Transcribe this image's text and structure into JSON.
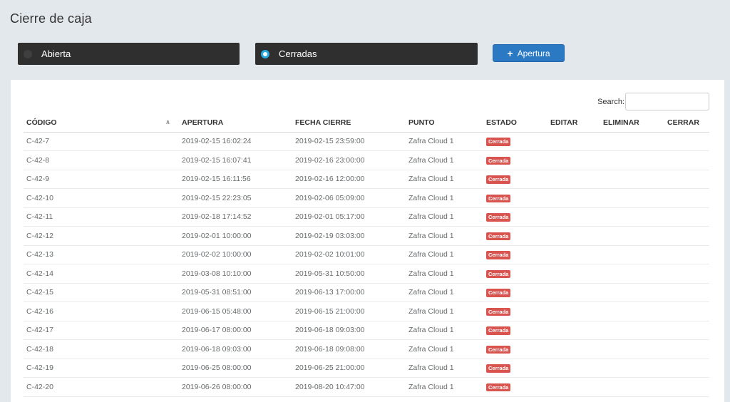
{
  "page": {
    "title": "Cierre de caja"
  },
  "filters": {
    "open_label": "Abierta",
    "closed_label": "Cerradas"
  },
  "actions": {
    "apertura_label": "Apertura"
  },
  "search": {
    "label": "Search:",
    "value": ""
  },
  "table": {
    "headers": {
      "codigo": "CÓDIGO",
      "apertura": "APERTURA",
      "fecha_cierre": "FECHA CIERRE",
      "punto": "PUNTO",
      "estado": "ESTADO",
      "editar": "EDITAR",
      "eliminar": "ELIMINAR",
      "cerrar": "CERRAR"
    },
    "rows": [
      {
        "codigo": "C-42-7",
        "apertura": "2019-02-15 16:02:24",
        "cierre": "2019-02-15 23:59:00",
        "punto": "Zafra Cloud 1",
        "estado": "Cerrada"
      },
      {
        "codigo": "C-42-8",
        "apertura": "2019-02-15 16:07:41",
        "cierre": "2019-02-16 23:00:00",
        "punto": "Zafra Cloud 1",
        "estado": "Cerrada"
      },
      {
        "codigo": "C-42-9",
        "apertura": "2019-02-15 16:11:56",
        "cierre": "2019-02-16 12:00:00",
        "punto": "Zafra Cloud 1",
        "estado": "Cerrada"
      },
      {
        "codigo": "C-42-10",
        "apertura": "2019-02-15 22:23:05",
        "cierre": "2019-02-06 05:09:00",
        "punto": "Zafra Cloud 1",
        "estado": "Cerrada"
      },
      {
        "codigo": "C-42-11",
        "apertura": "2019-02-18 17:14:52",
        "cierre": "2019-02-01 05:17:00",
        "punto": "Zafra Cloud 1",
        "estado": "Cerrada"
      },
      {
        "codigo": "C-42-12",
        "apertura": "2019-02-01 10:00:00",
        "cierre": "2019-02-19 03:03:00",
        "punto": "Zafra Cloud 1",
        "estado": "Cerrada"
      },
      {
        "codigo": "C-42-13",
        "apertura": "2019-02-02 10:00:00",
        "cierre": "2019-02-02 10:01:00",
        "punto": "Zafra Cloud 1",
        "estado": "Cerrada"
      },
      {
        "codigo": "C-42-14",
        "apertura": "2019-03-08 10:10:00",
        "cierre": "2019-05-31 10:50:00",
        "punto": "Zafra Cloud 1",
        "estado": "Cerrada"
      },
      {
        "codigo": "C-42-15",
        "apertura": "2019-05-31 08:51:00",
        "cierre": "2019-06-13 17:00:00",
        "punto": "Zafra Cloud 1",
        "estado": "Cerrada"
      },
      {
        "codigo": "C-42-16",
        "apertura": "2019-06-15 05:48:00",
        "cierre": "2019-06-15 21:00:00",
        "punto": "Zafra Cloud 1",
        "estado": "Cerrada"
      },
      {
        "codigo": "C-42-17",
        "apertura": "2019-06-17 08:00:00",
        "cierre": "2019-06-18 09:03:00",
        "punto": "Zafra Cloud 1",
        "estado": "Cerrada"
      },
      {
        "codigo": "C-42-18",
        "apertura": "2019-06-18 09:03:00",
        "cierre": "2019-06-18 09:08:00",
        "punto": "Zafra Cloud 1",
        "estado": "Cerrada"
      },
      {
        "codigo": "C-42-19",
        "apertura": "2019-06-25 08:00:00",
        "cierre": "2019-06-25 21:00:00",
        "punto": "Zafra Cloud 1",
        "estado": "Cerrada"
      },
      {
        "codigo": "C-42-20",
        "apertura": "2019-06-26 08:00:00",
        "cierre": "2019-08-20 10:47:00",
        "punto": "Zafra Cloud 1",
        "estado": "Cerrada"
      }
    ]
  },
  "colors": {
    "filter_bg": "#2f2f2f",
    "primary_button": "#2b79c2",
    "badge_closed": "#d9534f",
    "radio_accent": "#27a9e1"
  },
  "icons": {
    "sort": "sort-asc-icon",
    "plus": "plus-icon"
  }
}
